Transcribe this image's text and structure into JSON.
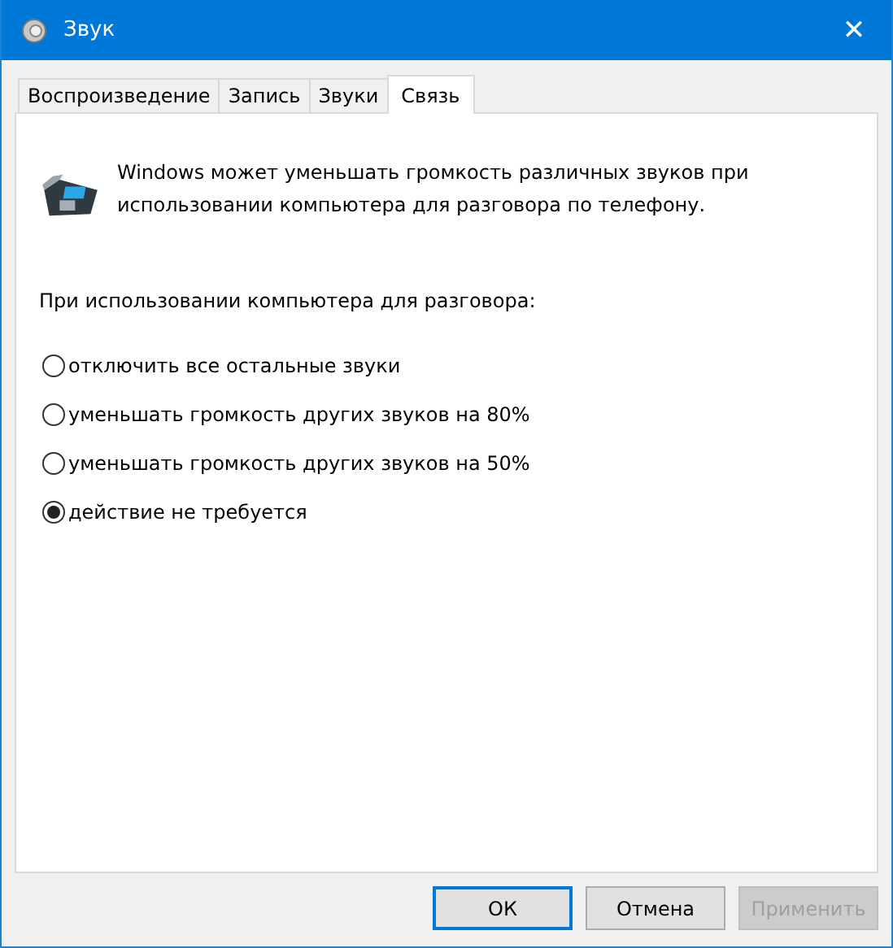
{
  "window": {
    "title": "Звук",
    "close": "✕"
  },
  "tabs": [
    {
      "label": "Воспроизведение",
      "selected": false
    },
    {
      "label": "Запись",
      "selected": false
    },
    {
      "label": "Звуки",
      "selected": false
    },
    {
      "label": "Связь",
      "selected": true
    }
  ],
  "intro": "Windows может уменьшать громкость различных звуков при использовании компьютера для разговора по телефону.",
  "group_label": "При использовании компьютера для разговора:",
  "options": [
    {
      "label": "отключить все остальные звуки",
      "selected": false
    },
    {
      "label": "уменьшать громкость других звуков на 80%",
      "selected": false
    },
    {
      "label": "уменьшать громкость других звуков на 50%",
      "selected": false
    },
    {
      "label": "действие не требуется",
      "selected": true
    }
  ],
  "buttons": [
    {
      "label": "ОК",
      "default": true,
      "disabled": false
    },
    {
      "label": "Отмена",
      "default": false,
      "disabled": false
    },
    {
      "label": "Применить",
      "default": false,
      "disabled": true
    }
  ]
}
